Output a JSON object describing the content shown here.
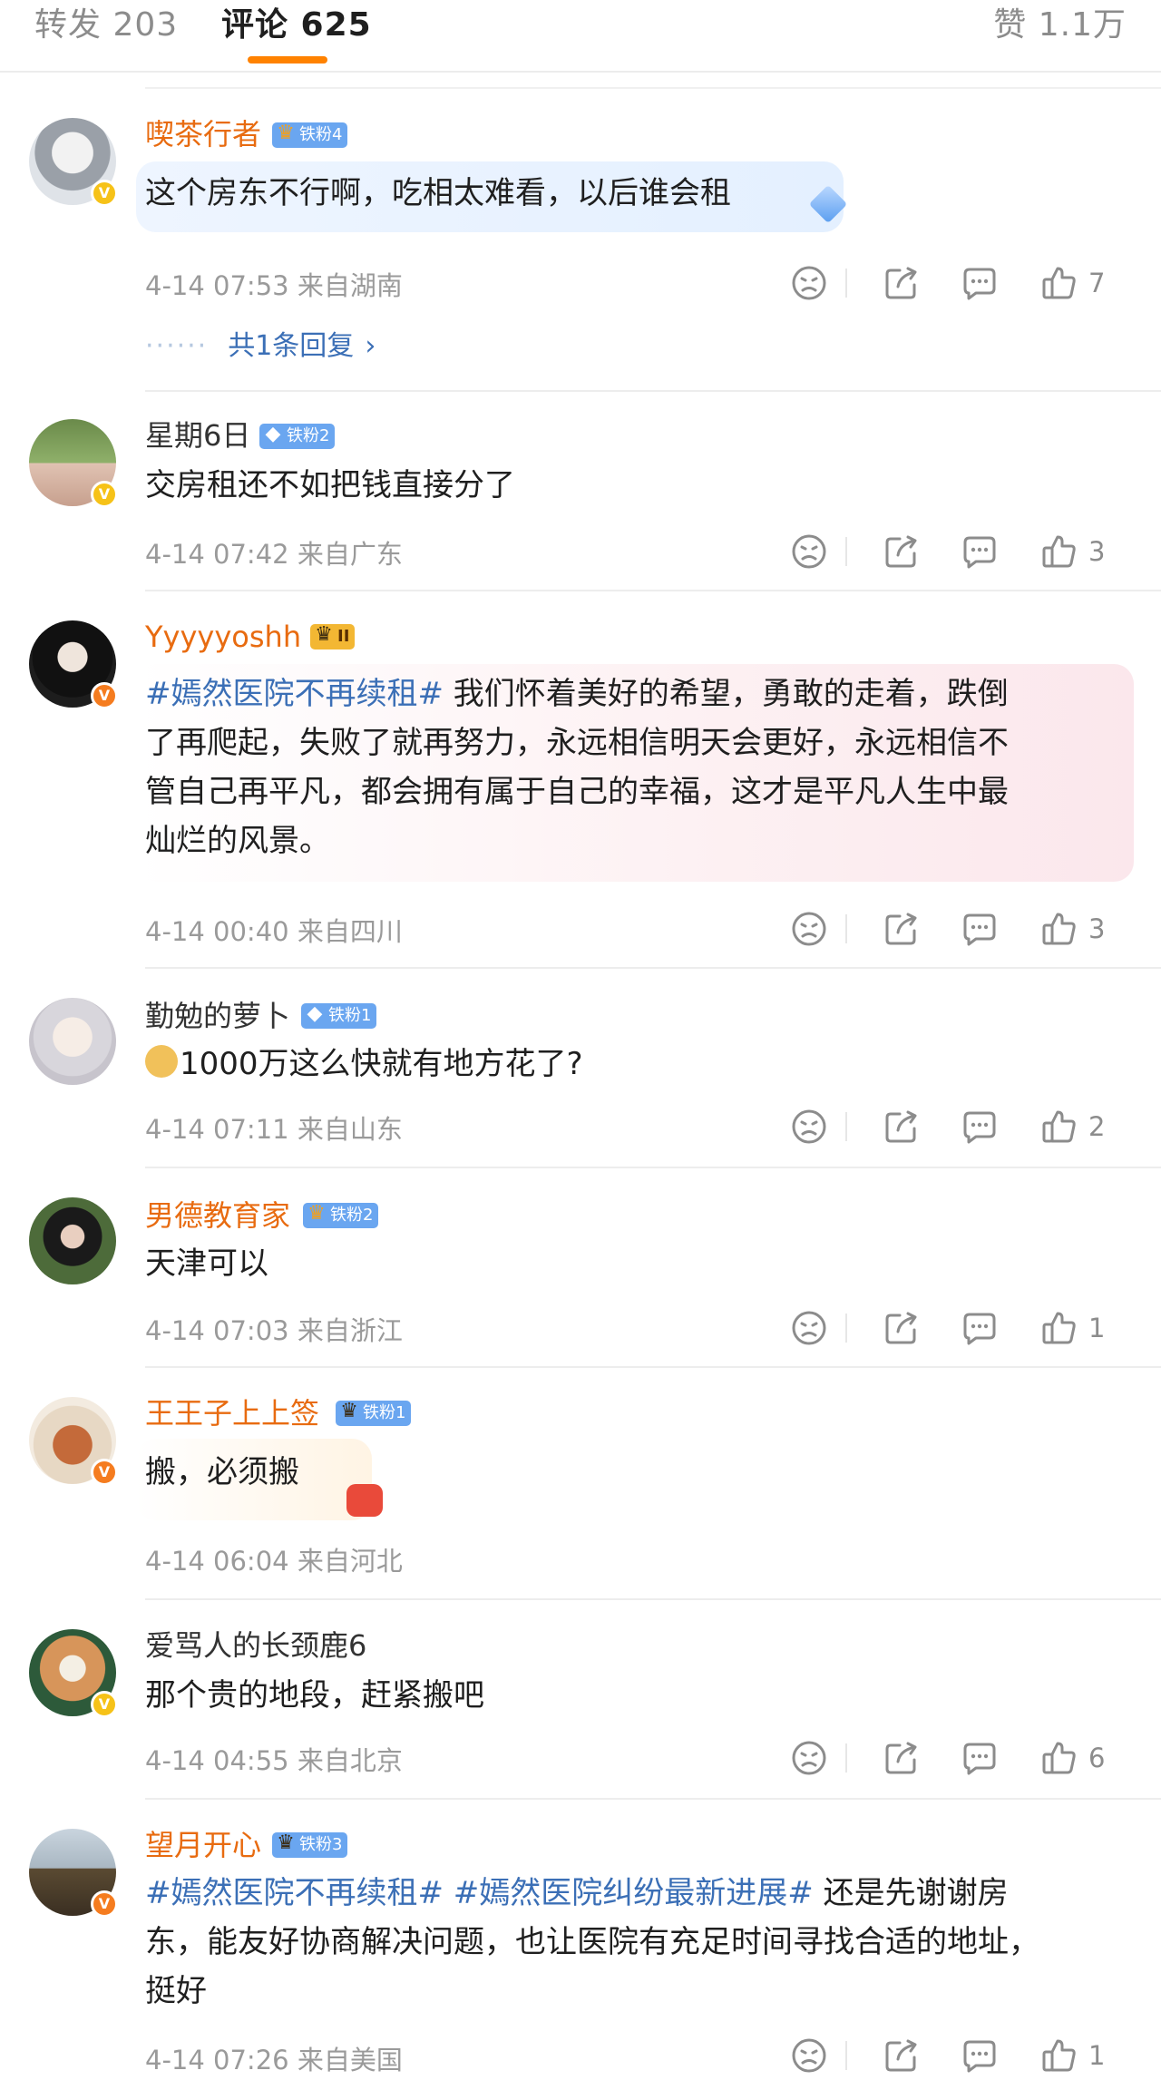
{
  "tabs": {
    "forward": "转发 203",
    "comments": "评论 625",
    "likes": "赞 1.1万"
  },
  "comments": [
    {
      "username": "喫茶行者",
      "badge": "铁粉4",
      "content": "这个房东不行啊，吃相太难看，以后谁会租",
      "meta": "4-14 07:53  来自湖南",
      "likes": "7",
      "replies": "共1条回复"
    },
    {
      "username": "星期6日",
      "badge": "铁粉2",
      "content": "交房租还不如把钱直接分了",
      "meta": "4-14 07:42  来自广东",
      "likes": "3"
    },
    {
      "username": "Yyyyyoshh",
      "badge": "II",
      "hashtag": "#嫣然医院不再续租#",
      "content_line1": " 我们怀着美好的希望，勇敢的走着，跌倒",
      "content_line2": "了再爬起，失败了就再努力，永远相信明天会更好，永远相信不",
      "content_line3": "管自己再平凡，都会拥有属于自己的幸福，这才是平凡人生中最",
      "content_line4": "灿烂的风景。",
      "meta": "4-14 00:40  来自四川",
      "likes": "3"
    },
    {
      "username": "勤勉的萝卜",
      "badge": "铁粉1",
      "content": "1000万这么快就有地方花了?",
      "meta": "4-14 07:11  来自山东",
      "likes": "2"
    },
    {
      "username": "男德教育家",
      "badge": "铁粉2",
      "content": "天津可以",
      "meta": "4-14 07:03  来自浙江",
      "likes": "1"
    },
    {
      "username": "王王子上上签",
      "badge": "铁粉1",
      "content": "搬，必须搬",
      "meta": "4-14 06:04  来自河北"
    },
    {
      "username": "爱骂人的长颈鹿6",
      "content": "那个贵的地段，赶紧搬吧",
      "meta": "4-14 04:55  来自北京",
      "likes": "6"
    },
    {
      "username": "望月开心",
      "badge": "铁粉3",
      "hashtag1": "#嫣然医院不再续租#",
      "hashtag2": "#嫣然医院纠纷最新进展#",
      "content_line1": " 还是先谢谢房",
      "content_line2": "东，能友好协商解决问题，也让医院有充足时间寻找合适的地址，",
      "content_line3": "挺好",
      "meta": "4-14 07:26  来自美国",
      "likes": "1"
    }
  ],
  "colors": {
    "accent": "#ff8200",
    "vip_name": "#e86b10",
    "hashtag": "#3b6fb6",
    "fan_badge": "#6aa6f0"
  },
  "icons": [
    "dislike-icon",
    "share-icon",
    "reply-icon",
    "like-icon",
    "verified-icon",
    "chevron-right-icon"
  ]
}
